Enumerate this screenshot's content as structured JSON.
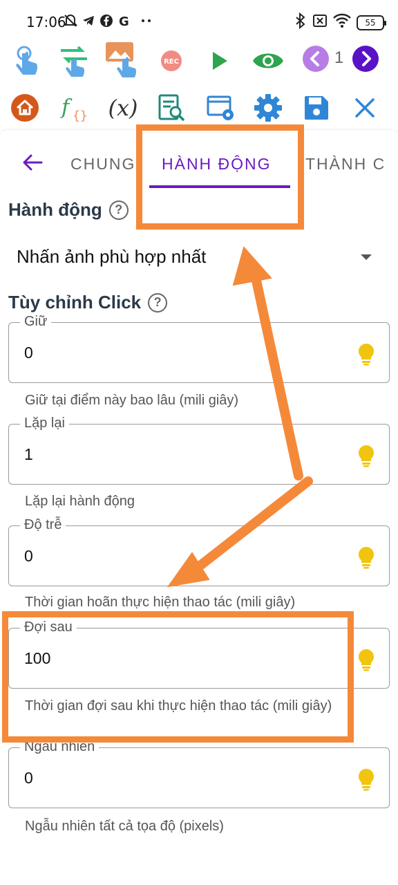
{
  "status_bar": {
    "time": "17:06",
    "battery": "55",
    "left_icons": [
      "mute-icon",
      "telegram-icon",
      "facebook-icon",
      "google-icon",
      "more-dots-icon"
    ],
    "right_icons": [
      "bluetooth-icon",
      "sim-off-icon",
      "wifi-icon"
    ]
  },
  "toolbar_top": {
    "items": [
      "tap-icon",
      "swipe-icon",
      "image-tap-icon",
      "record-icon",
      "play-icon",
      "eye-icon",
      "prev-icon",
      "next-icon"
    ],
    "page_number": "1"
  },
  "toolbar_bottom": {
    "items": [
      "home-icon",
      "function-icon",
      "variable-icon",
      "search-script-icon",
      "window-settings-icon",
      "settings-icon",
      "save-icon",
      "close-icon"
    ],
    "variable_label": "(x)"
  },
  "tabs": {
    "items": [
      {
        "label": "CHUNG",
        "active": false
      },
      {
        "label": "HÀNH ĐỘNG",
        "active": true
      },
      {
        "label": "THÀNH C",
        "active": false
      }
    ]
  },
  "action_section": {
    "title": "Hành động",
    "help": "?",
    "selected_action": "Nhấn ảnh phù hợp nhất"
  },
  "click_section": {
    "title": "Tùy chỉnh Click",
    "help": "?",
    "fields": [
      {
        "label": "Giữ",
        "value": "0",
        "helper": "Giữ tại điểm này bao lâu (mili giây)"
      },
      {
        "label": "Lặp lại",
        "value": "1",
        "helper": "Lặp lại hành động"
      },
      {
        "label": "Độ trễ",
        "value": "0",
        "helper": "Thời gian hoãn thực hiện thao tác (mili giây)"
      },
      {
        "label": "Đợi sau",
        "value": "100",
        "helper": "Thời gian đợi sau khi thực hiện thao tác (mili giây)"
      },
      {
        "label": "Ngẫu nhiên",
        "value": "0",
        "helper": "Ngẫu nhiên tất cả tọa độ (pixels)"
      }
    ]
  },
  "colors": {
    "accent": "#6a1bc0",
    "annotation": "#f5893a",
    "bulb": "#f1c40f",
    "blue_icon": "#2f86d6",
    "green": "#2ea44f",
    "home": "#d4581a"
  }
}
